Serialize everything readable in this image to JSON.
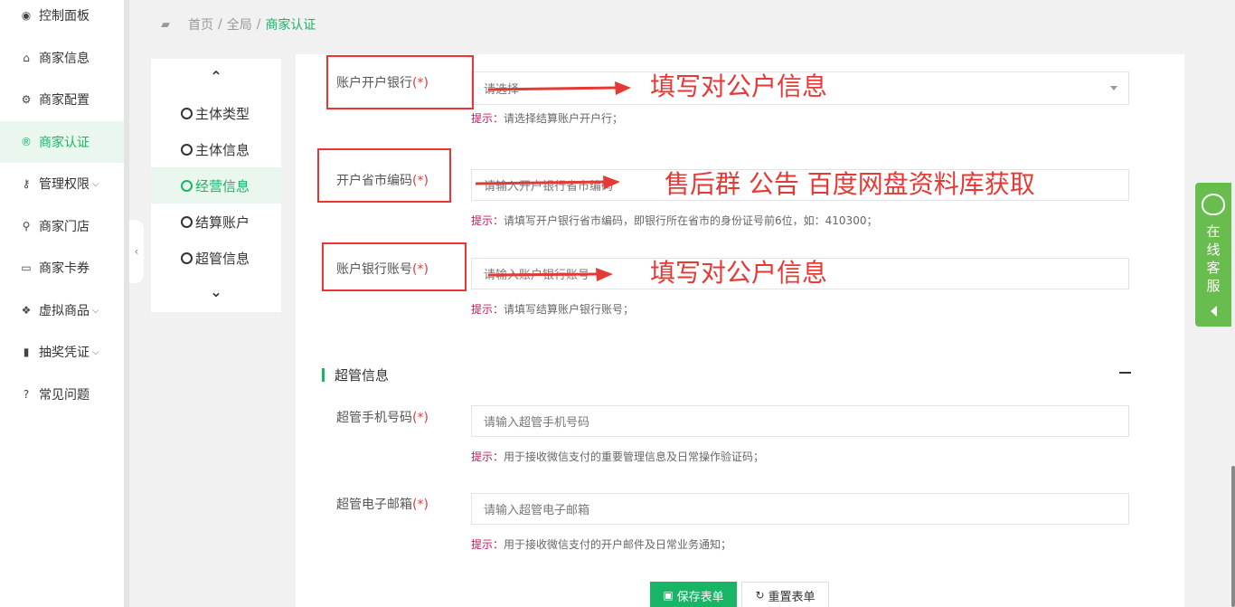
{
  "sidebar": {
    "items": [
      {
        "label": "控制面板",
        "icon": "dashboard-icon",
        "active": false,
        "chevron": false
      },
      {
        "label": "商家信息",
        "icon": "home-icon",
        "active": false,
        "chevron": false
      },
      {
        "label": "商家配置",
        "icon": "gears-icon",
        "active": false,
        "chevron": false
      },
      {
        "label": "商家认证",
        "icon": "registered-icon",
        "active": true,
        "chevron": false
      },
      {
        "label": "管理权限",
        "icon": "key-icon",
        "active": false,
        "chevron": true
      },
      {
        "label": "商家门店",
        "icon": "map-marker-icon",
        "active": false,
        "chevron": false
      },
      {
        "label": "商家卡券",
        "icon": "credit-card-icon",
        "active": false,
        "chevron": false
      },
      {
        "label": "虚拟商品",
        "icon": "dropbox-icon",
        "active": false,
        "chevron": true
      },
      {
        "label": "抽奖凭证",
        "icon": "bookmark-icon",
        "active": false,
        "chevron": true
      },
      {
        "label": "常见问题",
        "icon": "question-circle-icon",
        "active": false,
        "chevron": false
      }
    ],
    "chevron_glyph": "⌵"
  },
  "breadcrumb": {
    "home": "首页",
    "sep": "/",
    "level2": "全局",
    "current": "商家认证"
  },
  "anchor_nav": {
    "up_glyph": "⌃",
    "down_glyph": "⌄",
    "collapse_glyph": "‹",
    "items": [
      "主体类型",
      "主体信息",
      "经营信息",
      "结算账户",
      "超管信息"
    ],
    "active_index": 2
  },
  "form": {
    "bank": {
      "label": "账户开户银行",
      "req": "(*)",
      "value": "请选择",
      "hint_key": "提示：",
      "hint": "请选择结算账户开户行；"
    },
    "province_code": {
      "label": "开户省市编码",
      "req": "(*)",
      "placeholder": "请输入开户银行省市编码",
      "hint_key": "提示：",
      "hint": "请填写开户银行省市编码，即银行所在省市的身份证号前6位，如：410300；"
    },
    "account_no": {
      "label": "账户银行账号",
      "req": "(*)",
      "placeholder": "请输入账户银行账号",
      "hint_key": "提示：",
      "hint": "请填写结算账户银行账号；"
    },
    "admin_section": {
      "title": "超管信息"
    },
    "admin_phone": {
      "label": "超管手机号码",
      "req": "(*)",
      "placeholder": "请输入超管手机号码",
      "hint_key": "提示：",
      "hint": "用于接收微信支付的重要管理信息及日常操作验证码；"
    },
    "admin_email": {
      "label": "超管电子邮箱",
      "req": "(*)",
      "placeholder": "请输入超管电子邮箱",
      "hint_key": "提示：",
      "hint": "用于接收微信支付的开户邮件及日常业务通知；"
    }
  },
  "buttons": {
    "save": "保存表单",
    "reset": "重置表单"
  },
  "annotations": {
    "bank": "填写对公户信息",
    "province": "售后群 公告 百度网盘资料库获取",
    "account": "填写对公户信息"
  },
  "service": {
    "chars": [
      "在",
      "线",
      "客",
      "服"
    ]
  },
  "colors": {
    "accent": "#18b566",
    "annotation": "#e53935",
    "required": "#e4393c",
    "service": "#69bd4f"
  }
}
